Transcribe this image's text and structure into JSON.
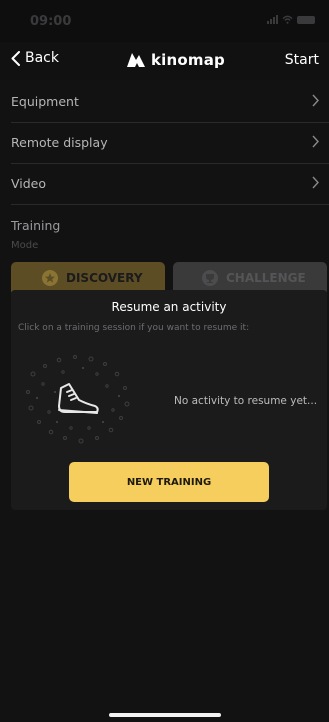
{
  "status_bar": {
    "time": "09:00"
  },
  "nav": {
    "back_label": "Back",
    "logo_text": "kinomap",
    "start_label": "Start"
  },
  "menu": {
    "items": [
      {
        "label": "Equipment",
        "icon": "chevron-right-icon"
      },
      {
        "label": "Remote display",
        "icon": "chevron-right-icon"
      },
      {
        "label": "Video",
        "icon": "chevron-right-icon"
      }
    ]
  },
  "training": {
    "section_label": "Training",
    "mode_label": "Mode",
    "modes": [
      {
        "label": "DISCOVERY",
        "icon": "discovery-icon",
        "selected": true
      },
      {
        "label": "CHALLENGE",
        "icon": "challenge-icon",
        "selected": false
      }
    ]
  },
  "modal": {
    "title": "Resume an activity",
    "subtitle": "Click on a training session if you want to resume it:",
    "empty_text": "No activity to resume yet...",
    "illustration": "sneaker-icon",
    "new_training_label": "NEW TRAINING"
  },
  "colors": {
    "accent": "#f5ce5e",
    "background": "#121213",
    "modal": "#1b1b1c"
  }
}
